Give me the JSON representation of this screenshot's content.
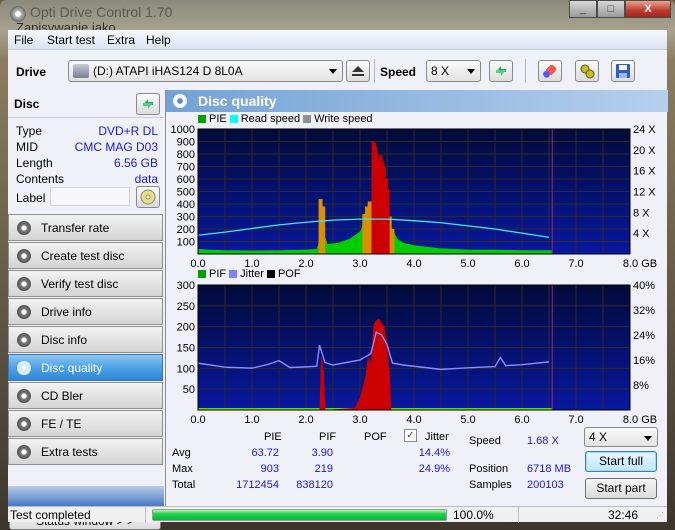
{
  "window": {
    "title": "Opti Drive Control 1.70",
    "overlay_title": "Zapisywanie jako",
    "minimize": "_",
    "maximize": "□",
    "close": "X"
  },
  "menu": [
    "File",
    "Start test",
    "Extra",
    "Help"
  ],
  "toolbar": {
    "drive_label": "Drive",
    "drive_value": "(D:)   ATAPI iHAS124   D 8L0A",
    "speed_label": "Speed",
    "speed_value": "8 X"
  },
  "disc": {
    "header": "Disc",
    "rows": [
      {
        "label": "Type",
        "value": "DVD+R DL"
      },
      {
        "label": "MID",
        "value": "CMC MAG D03"
      },
      {
        "label": "Length",
        "value": "6.56 GB"
      },
      {
        "label": "Contents",
        "value": "data"
      }
    ],
    "label_field_label": "Label",
    "label_field_value": ""
  },
  "nav": [
    {
      "label": "Transfer rate",
      "active": false
    },
    {
      "label": "Create test disc",
      "active": false
    },
    {
      "label": "Verify test disc",
      "active": false
    },
    {
      "label": "Drive info",
      "active": false
    },
    {
      "label": "Disc info",
      "active": false
    },
    {
      "label": "Disc quality",
      "active": true
    },
    {
      "label": "CD Bler",
      "active": false
    },
    {
      "label": "FE / TE",
      "active": false
    },
    {
      "label": "Extra tests",
      "active": false
    }
  ],
  "status_window_button": "Status window > >",
  "panel_title": "Disc quality",
  "chart_data": [
    {
      "type": "area",
      "title": "PIE / Read speed",
      "legend": [
        {
          "name": "PIE",
          "color": "#00a000"
        },
        {
          "name": "Read speed",
          "color": "#00ffff"
        },
        {
          "name": "Write speed",
          "color": "#909090"
        }
      ],
      "xlim": [
        0,
        8.0
      ],
      "x_ticks": [
        "0.0",
        "1.0",
        "2.0",
        "3.0",
        "4.0",
        "5.0",
        "6.0",
        "7.0",
        "8.0 GB"
      ],
      "ylim": [
        0,
        1000
      ],
      "y_ticks": [
        "100",
        "200",
        "300",
        "400",
        "500",
        "600",
        "700",
        "800",
        "900",
        "1000"
      ],
      "y2lim": [
        0,
        24
      ],
      "y2_ticks": [
        "4 X",
        "8 X",
        "12 X",
        "16 X",
        "20 X",
        "24 X"
      ],
      "disc_end_gb": 6.56,
      "pie_green": {
        "x": [
          0,
          0.2,
          0.5,
          1.0,
          1.5,
          2.0,
          2.2,
          2.3,
          2.4,
          2.6,
          2.8,
          3.0,
          3.1,
          3.2,
          3.5,
          3.6,
          3.7,
          3.8,
          4.0,
          4.2,
          4.5,
          5.0,
          5.5,
          6.0,
          6.5,
          6.56
        ],
        "y": [
          40,
          35,
          30,
          28,
          30,
          35,
          40,
          200,
          80,
          90,
          120,
          180,
          280,
          320,
          300,
          200,
          120,
          90,
          70,
          60,
          45,
          35,
          35,
          30,
          30,
          30
        ]
      },
      "pie_orange": [
        {
          "x": 2.27,
          "y": 440
        },
        {
          "x": 2.32,
          "y": 380
        },
        {
          "x": 3.08,
          "y": 320
        },
        {
          "x": 3.13,
          "y": 380
        },
        {
          "x": 3.18,
          "y": 420
        },
        {
          "x": 3.55,
          "y": 300
        },
        {
          "x": 3.6,
          "y": 200
        }
      ],
      "pie_red": {
        "x": [
          3.25,
          3.28,
          3.3,
          3.33,
          3.36,
          3.4,
          3.43,
          3.46,
          3.5,
          3.53
        ],
        "y": [
          903,
          890,
          860,
          800,
          760,
          790,
          740,
          700,
          600,
          520
        ]
      },
      "read_speed": {
        "x": [
          0,
          0.5,
          1.0,
          1.5,
          2.0,
          2.5,
          3.0,
          3.5,
          4.0,
          4.5,
          5.0,
          5.5,
          6.0,
          6.5
        ],
        "y": [
          3.6,
          4.2,
          4.9,
          5.6,
          6.1,
          6.5,
          6.7,
          6.7,
          6.4,
          6.0,
          5.4,
          4.8,
          4.0,
          3.2
        ]
      }
    },
    {
      "type": "area",
      "title": "PIF / Jitter",
      "legend": [
        {
          "name": "PIF",
          "color": "#00a000"
        },
        {
          "name": "Jitter",
          "color": "#8080ff"
        },
        {
          "name": "POF",
          "color": "#000000"
        }
      ],
      "xlim": [
        0,
        8.0
      ],
      "x_ticks": [
        "0.0",
        "1.0",
        "2.0",
        "3.0",
        "4.0",
        "5.0",
        "6.0",
        "7.0",
        "8.0 GB"
      ],
      "ylim": [
        0,
        300
      ],
      "y_ticks": [
        "50",
        "100",
        "150",
        "200",
        "250",
        "300"
      ],
      "y2lim": [
        0,
        40
      ],
      "y2_ticks": [
        "8%",
        "16%",
        "24%",
        "32%",
        "40%"
      ],
      "disc_end_gb": 6.56,
      "pif_red": {
        "x": [
          2.25,
          2.28,
          2.3,
          2.33,
          2.36,
          2.9,
          3.0,
          3.1,
          3.15,
          3.2,
          3.25,
          3.3,
          3.35,
          3.4,
          3.45,
          3.5,
          3.55,
          3.58
        ],
        "y": [
          0,
          130,
          120,
          90,
          0,
          5,
          30,
          80,
          130,
          110,
          205,
          215,
          219,
          210,
          200,
          160,
          90,
          0
        ]
      },
      "jitter": {
        "x": [
          0,
          0.5,
          1.0,
          1.3,
          1.5,
          1.7,
          2.0,
          2.2,
          2.25,
          2.35,
          2.5,
          3.0,
          3.2,
          3.3,
          3.4,
          3.5,
          3.6,
          3.8,
          4.0,
          4.5,
          5.0,
          5.5,
          5.6,
          5.7,
          6.0,
          6.5
        ],
        "y": [
          15.0,
          13.7,
          13.4,
          14.6,
          15.8,
          13.6,
          13.8,
          14.0,
          20.8,
          15.2,
          14.4,
          16.0,
          18.0,
          24.9,
          24.0,
          21.0,
          15.0,
          14.4,
          14.0,
          13.0,
          13.5,
          13.9,
          16.8,
          14.2,
          14.5,
          15.4
        ]
      }
    }
  ],
  "stats": {
    "headers": [
      "PIE",
      "PIF",
      "POF",
      "Jitter"
    ],
    "jitter_checked": true,
    "rows": [
      {
        "label": "Avg",
        "pie": "63.72",
        "pif": "3.90",
        "pof": "",
        "jitter": "14.4%"
      },
      {
        "label": "Max",
        "pie": "903",
        "pif": "219",
        "pof": "",
        "jitter": "24.9%"
      },
      {
        "label": "Total",
        "pie": "1712454",
        "pif": "838120",
        "pof": "",
        "jitter": ""
      }
    ],
    "speed_label": "Speed",
    "speed_value": "1.68 X",
    "position_label": "Position",
    "position_value": "6718 MB",
    "samples_label": "Samples",
    "samples_value": "200103",
    "test_speed": "4 X",
    "start_full": "Start full",
    "start_part": "Start part"
  },
  "statusbar": {
    "message": "Test completed",
    "progress_percent": 100.0,
    "progress_text": "100.0%",
    "elapsed": "32:46"
  }
}
